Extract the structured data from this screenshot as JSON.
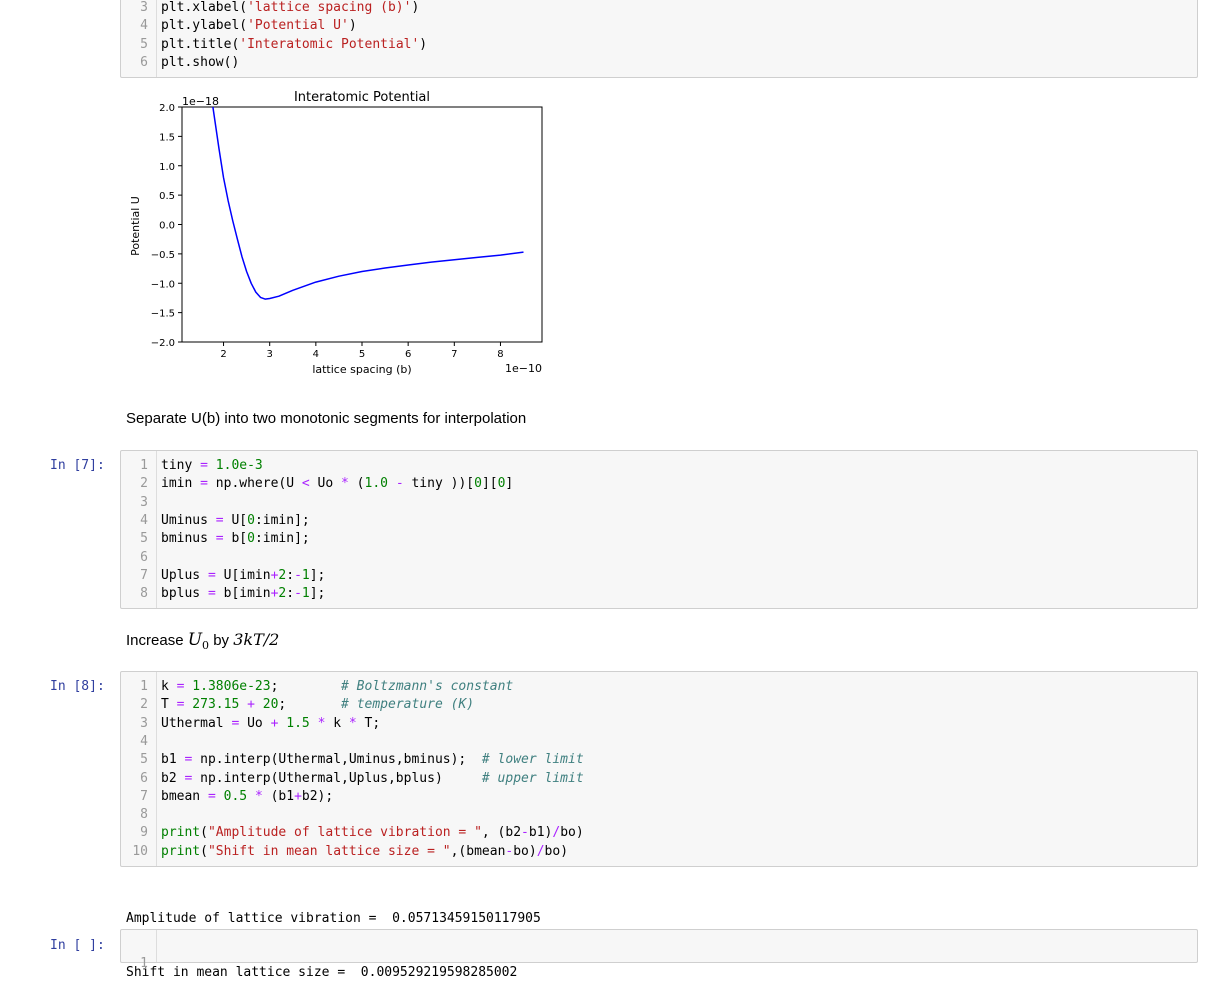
{
  "cell_top": {
    "lines": [
      {
        "n": "3",
        "parts": [
          {
            "t": "plt.xlabel(",
            "c": ""
          },
          {
            "t": "'lattice spacing (b)'",
            "c": "str"
          },
          {
            "t": ")",
            "c": ""
          }
        ]
      },
      {
        "n": "4",
        "parts": [
          {
            "t": "plt.ylabel(",
            "c": ""
          },
          {
            "t": "'Potential U'",
            "c": "str"
          },
          {
            "t": ")",
            "c": ""
          }
        ]
      },
      {
        "n": "5",
        "parts": [
          {
            "t": "plt.title(",
            "c": ""
          },
          {
            "t": "'Interatomic Potential'",
            "c": "str"
          },
          {
            "t": ")",
            "c": ""
          }
        ]
      },
      {
        "n": "6",
        "parts": [
          {
            "t": "plt.show()",
            "c": ""
          }
        ]
      }
    ]
  },
  "chart_data": {
    "type": "line",
    "title": "Interatomic Potential",
    "xlabel": "lattice spacing (b)",
    "ylabel": "Potential U",
    "x_offset_text": "1e−10",
    "y_offset_text": "1e−18",
    "xlim": [
      1.1,
      8.9
    ],
    "ylim": [
      -2.0,
      2.0
    ],
    "xticks": [
      "2",
      "3",
      "4",
      "5",
      "6",
      "7",
      "8"
    ],
    "yticks": [
      "2.0",
      "1.5",
      "1.0",
      "0.5",
      "0.0",
      "−0.5",
      "−1.0",
      "−1.5",
      "−2.0"
    ],
    "series": [
      {
        "color": "#0000ff",
        "x": [
          1.77,
          1.9,
          2.0,
          2.1,
          2.2,
          2.3,
          2.4,
          2.5,
          2.6,
          2.7,
          2.8,
          2.9,
          3.0,
          3.2,
          3.5,
          4.0,
          4.5,
          5.0,
          5.5,
          6.0,
          6.5,
          7.0,
          7.5,
          8.0,
          8.5
        ],
        "y": [
          2.0,
          1.3,
          0.8,
          0.4,
          0.06,
          -0.25,
          -0.55,
          -0.8,
          -1.0,
          -1.15,
          -1.24,
          -1.27,
          -1.26,
          -1.22,
          -1.12,
          -0.98,
          -0.88,
          -0.8,
          -0.74,
          -0.69,
          -0.64,
          -0.6,
          -0.56,
          -0.52,
          -0.47
        ]
      }
    ]
  },
  "markdown1": "Separate U(b) into two monotonic segments for interpolation",
  "cell7": {
    "prompt": "In [7]:",
    "lines": [
      {
        "n": "1",
        "parts": [
          {
            "t": "tiny ",
            "c": ""
          },
          {
            "t": "=",
            "c": "op"
          },
          {
            "t": " 1.0e-3",
            "c": "num"
          }
        ]
      },
      {
        "n": "2",
        "parts": [
          {
            "t": "imin ",
            "c": ""
          },
          {
            "t": "=",
            "c": "op"
          },
          {
            "t": " np.where(U ",
            "c": ""
          },
          {
            "t": "<",
            "c": "op"
          },
          {
            "t": " Uo ",
            "c": ""
          },
          {
            "t": "*",
            "c": "op"
          },
          {
            "t": " (",
            "c": ""
          },
          {
            "t": "1.0",
            "c": "num"
          },
          {
            "t": " ",
            "c": ""
          },
          {
            "t": "-",
            "c": "op"
          },
          {
            "t": " tiny ))[",
            "c": ""
          },
          {
            "t": "0",
            "c": "num"
          },
          {
            "t": "][",
            "c": ""
          },
          {
            "t": "0",
            "c": "num"
          },
          {
            "t": "]",
            "c": ""
          }
        ]
      },
      {
        "n": "3",
        "parts": [
          {
            "t": "",
            "c": ""
          }
        ]
      },
      {
        "n": "4",
        "parts": [
          {
            "t": "Uminus ",
            "c": ""
          },
          {
            "t": "=",
            "c": "op"
          },
          {
            "t": " U[",
            "c": ""
          },
          {
            "t": "0",
            "c": "num"
          },
          {
            "t": ":imin];",
            "c": ""
          }
        ]
      },
      {
        "n": "5",
        "parts": [
          {
            "t": "bminus ",
            "c": ""
          },
          {
            "t": "=",
            "c": "op"
          },
          {
            "t": " b[",
            "c": ""
          },
          {
            "t": "0",
            "c": "num"
          },
          {
            "t": ":imin];",
            "c": ""
          }
        ]
      },
      {
        "n": "6",
        "parts": [
          {
            "t": "",
            "c": ""
          }
        ]
      },
      {
        "n": "7",
        "parts": [
          {
            "t": "Uplus ",
            "c": ""
          },
          {
            "t": "=",
            "c": "op"
          },
          {
            "t": " U[imin",
            "c": ""
          },
          {
            "t": "+",
            "c": "op"
          },
          {
            "t": "2",
            "c": "num"
          },
          {
            "t": ":",
            "c": ""
          },
          {
            "t": "-",
            "c": "op"
          },
          {
            "t": "1",
            "c": "num"
          },
          {
            "t": "];",
            "c": ""
          }
        ]
      },
      {
        "n": "8",
        "parts": [
          {
            "t": "bplus ",
            "c": ""
          },
          {
            "t": "=",
            "c": "op"
          },
          {
            "t": " b[imin",
            "c": ""
          },
          {
            "t": "+",
            "c": "op"
          },
          {
            "t": "2",
            "c": "num"
          },
          {
            "t": ":",
            "c": ""
          },
          {
            "t": "-",
            "c": "op"
          },
          {
            "t": "1",
            "c": "num"
          },
          {
            "t": "];",
            "c": ""
          }
        ]
      }
    ]
  },
  "markdown2": {
    "pre": "Increase ",
    "var": "U",
    "sub": "0",
    "mid": " by ",
    "expr": "3kT/2"
  },
  "cell8": {
    "prompt": "In [8]:",
    "lines": [
      {
        "n": "1",
        "parts": [
          {
            "t": "k ",
            "c": ""
          },
          {
            "t": "=",
            "c": "op"
          },
          {
            "t": " 1.3806e-23",
            "c": "num"
          },
          {
            "t": ";        ",
            "c": ""
          },
          {
            "t": "# Boltzmann's constant",
            "c": "cm"
          }
        ]
      },
      {
        "n": "2",
        "parts": [
          {
            "t": "T ",
            "c": ""
          },
          {
            "t": "=",
            "c": "op"
          },
          {
            "t": " 273.15",
            "c": "num"
          },
          {
            "t": " ",
            "c": ""
          },
          {
            "t": "+",
            "c": "op"
          },
          {
            "t": " 20",
            "c": "num"
          },
          {
            "t": ";       ",
            "c": ""
          },
          {
            "t": "# temperature (K)",
            "c": "cm"
          }
        ]
      },
      {
        "n": "3",
        "parts": [
          {
            "t": "Uthermal ",
            "c": ""
          },
          {
            "t": "=",
            "c": "op"
          },
          {
            "t": " Uo ",
            "c": ""
          },
          {
            "t": "+",
            "c": "op"
          },
          {
            "t": " 1.5",
            "c": "num"
          },
          {
            "t": " ",
            "c": ""
          },
          {
            "t": "*",
            "c": "op"
          },
          {
            "t": " k ",
            "c": ""
          },
          {
            "t": "*",
            "c": "op"
          },
          {
            "t": " T;",
            "c": ""
          }
        ]
      },
      {
        "n": "4",
        "parts": [
          {
            "t": "",
            "c": ""
          }
        ]
      },
      {
        "n": "5",
        "parts": [
          {
            "t": "b1 ",
            "c": ""
          },
          {
            "t": "=",
            "c": "op"
          },
          {
            "t": " np.interp(Uthermal,Uminus,bminus);  ",
            "c": ""
          },
          {
            "t": "# lower limit",
            "c": "cm"
          }
        ]
      },
      {
        "n": "6",
        "parts": [
          {
            "t": "b2 ",
            "c": ""
          },
          {
            "t": "=",
            "c": "op"
          },
          {
            "t": " np.interp(Uthermal,Uplus,bplus)     ",
            "c": ""
          },
          {
            "t": "# upper limit",
            "c": "cm"
          }
        ]
      },
      {
        "n": "7",
        "parts": [
          {
            "t": "bmean ",
            "c": ""
          },
          {
            "t": "=",
            "c": "op"
          },
          {
            "t": " 0.5",
            "c": "num"
          },
          {
            "t": " ",
            "c": ""
          },
          {
            "t": "*",
            "c": "op"
          },
          {
            "t": " (b1",
            "c": ""
          },
          {
            "t": "+",
            "c": "op"
          },
          {
            "t": "b2);",
            "c": ""
          }
        ]
      },
      {
        "n": "8",
        "parts": [
          {
            "t": "",
            "c": ""
          }
        ]
      },
      {
        "n": "9",
        "parts": [
          {
            "t": "print",
            "c": "kw"
          },
          {
            "t": "(",
            "c": ""
          },
          {
            "t": "\"Amplitude of lattice vibration = \"",
            "c": "str"
          },
          {
            "t": ", (b2",
            "c": ""
          },
          {
            "t": "-",
            "c": "op"
          },
          {
            "t": "b1)",
            "c": ""
          },
          {
            "t": "/",
            "c": "op"
          },
          {
            "t": "bo)",
            "c": ""
          }
        ]
      },
      {
        "n": "10",
        "parts": [
          {
            "t": "print",
            "c": "kw"
          },
          {
            "t": "(",
            "c": ""
          },
          {
            "t": "\"Shift in mean lattice size = \"",
            "c": "str"
          },
          {
            "t": ",(bmean",
            "c": ""
          },
          {
            "t": "-",
            "c": "op"
          },
          {
            "t": "bo)",
            "c": ""
          },
          {
            "t": "/",
            "c": "op"
          },
          {
            "t": "bo)",
            "c": ""
          }
        ]
      }
    ]
  },
  "output8": {
    "line1": "Amplitude of lattice vibration =  0.05713459150117905",
    "line2": "Shift in mean lattice size =  0.009529219598285002"
  },
  "cell_empty": {
    "prompt": "In [ ]:",
    "line": "1"
  }
}
